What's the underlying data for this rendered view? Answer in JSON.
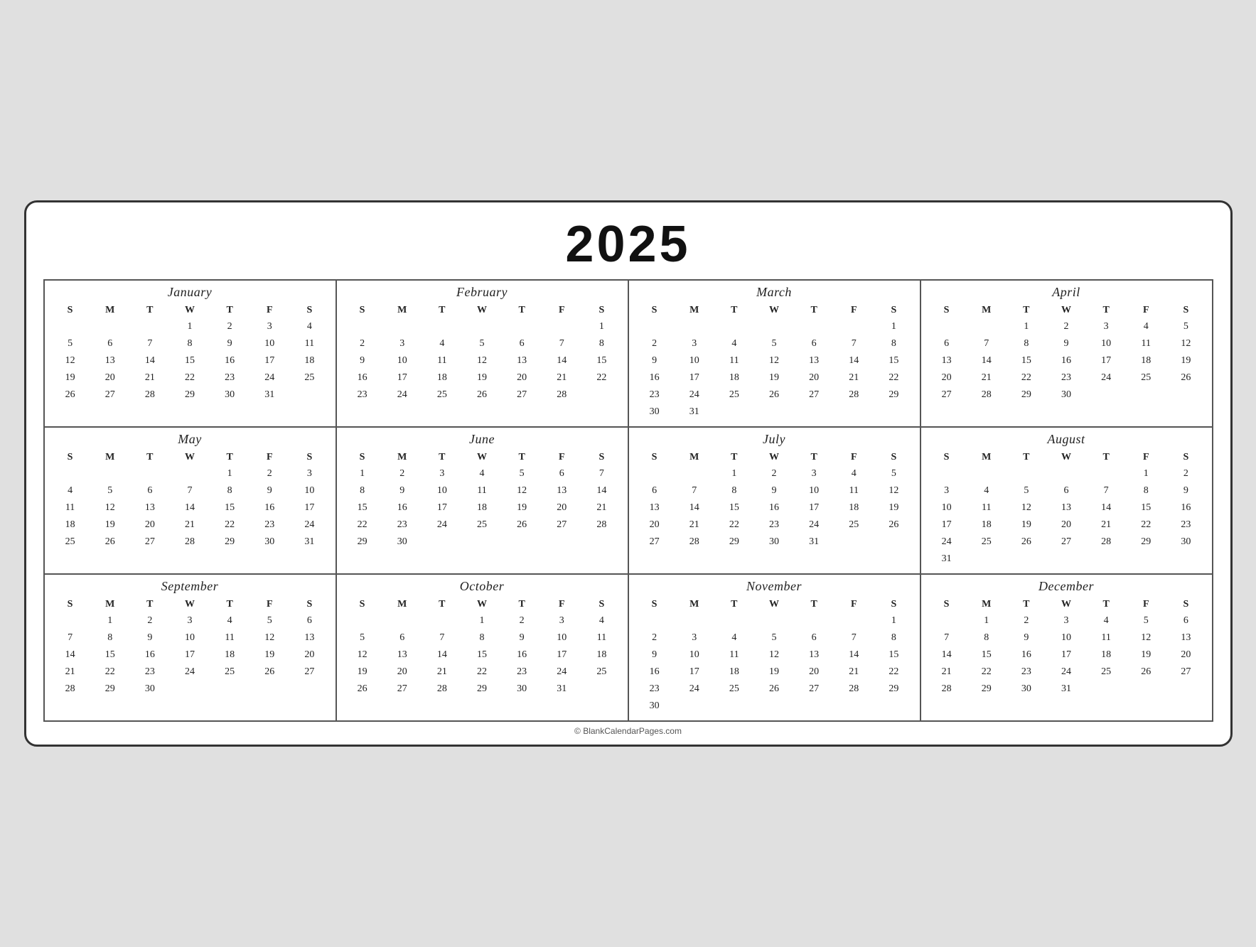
{
  "year": "2025",
  "footer": "© BlankCalendarPages.com",
  "months": [
    {
      "name": "January",
      "days_header": [
        "S",
        "M",
        "T",
        "W",
        "T",
        "F",
        "S"
      ],
      "weeks": [
        [
          "",
          "",
          "",
          "1",
          "2",
          "3",
          "4"
        ],
        [
          "5",
          "6",
          "7",
          "8",
          "9",
          "10",
          "11"
        ],
        [
          "12",
          "13",
          "14",
          "15",
          "16",
          "17",
          "18"
        ],
        [
          "19",
          "20",
          "21",
          "22",
          "23",
          "24",
          "25"
        ],
        [
          "26",
          "27",
          "28",
          "29",
          "30",
          "31",
          ""
        ]
      ]
    },
    {
      "name": "February",
      "days_header": [
        "S",
        "M",
        "T",
        "W",
        "T",
        "F",
        "S"
      ],
      "weeks": [
        [
          "",
          "",
          "",
          "",
          "",
          "",
          "1"
        ],
        [
          "2",
          "3",
          "4",
          "5",
          "6",
          "7",
          "8"
        ],
        [
          "9",
          "10",
          "11",
          "12",
          "13",
          "14",
          "15"
        ],
        [
          "16",
          "17",
          "18",
          "19",
          "20",
          "21",
          "22"
        ],
        [
          "23",
          "24",
          "25",
          "26",
          "27",
          "28",
          ""
        ]
      ]
    },
    {
      "name": "March",
      "days_header": [
        "S",
        "M",
        "T",
        "W",
        "T",
        "F",
        "S"
      ],
      "weeks": [
        [
          "",
          "",
          "",
          "",
          "",
          "",
          "1"
        ],
        [
          "2",
          "3",
          "4",
          "5",
          "6",
          "7",
          "8"
        ],
        [
          "9",
          "10",
          "11",
          "12",
          "13",
          "14",
          "15"
        ],
        [
          "16",
          "17",
          "18",
          "19",
          "20",
          "21",
          "22"
        ],
        [
          "23",
          "24",
          "25",
          "26",
          "27",
          "28",
          "29"
        ],
        [
          "30",
          "31",
          "",
          "",
          "",
          "",
          ""
        ]
      ]
    },
    {
      "name": "April",
      "days_header": [
        "S",
        "M",
        "T",
        "W",
        "T",
        "F",
        "S"
      ],
      "weeks": [
        [
          "",
          "",
          "1",
          "2",
          "3",
          "4",
          "5"
        ],
        [
          "6",
          "7",
          "8",
          "9",
          "10",
          "11",
          "12"
        ],
        [
          "13",
          "14",
          "15",
          "16",
          "17",
          "18",
          "19"
        ],
        [
          "20",
          "21",
          "22",
          "23",
          "24",
          "25",
          "26"
        ],
        [
          "27",
          "28",
          "29",
          "30",
          "",
          "",
          ""
        ]
      ]
    },
    {
      "name": "May",
      "days_header": [
        "S",
        "M",
        "T",
        "W",
        "T",
        "F",
        "S"
      ],
      "weeks": [
        [
          "",
          "",
          "",
          "",
          "1",
          "2",
          "3"
        ],
        [
          "4",
          "5",
          "6",
          "7",
          "8",
          "9",
          "10"
        ],
        [
          "11",
          "12",
          "13",
          "14",
          "15",
          "16",
          "17"
        ],
        [
          "18",
          "19",
          "20",
          "21",
          "22",
          "23",
          "24"
        ],
        [
          "25",
          "26",
          "27",
          "28",
          "29",
          "30",
          "31"
        ]
      ]
    },
    {
      "name": "June",
      "days_header": [
        "S",
        "M",
        "T",
        "W",
        "T",
        "F",
        "S"
      ],
      "weeks": [
        [
          "1",
          "2",
          "3",
          "4",
          "5",
          "6",
          "7"
        ],
        [
          "8",
          "9",
          "10",
          "11",
          "12",
          "13",
          "14"
        ],
        [
          "15",
          "16",
          "17",
          "18",
          "19",
          "20",
          "21"
        ],
        [
          "22",
          "23",
          "24",
          "25",
          "26",
          "27",
          "28"
        ],
        [
          "29",
          "30",
          "",
          "",
          "",
          "",
          ""
        ]
      ]
    },
    {
      "name": "July",
      "days_header": [
        "S",
        "M",
        "T",
        "W",
        "T",
        "F",
        "S"
      ],
      "weeks": [
        [
          "",
          "",
          "1",
          "2",
          "3",
          "4",
          "5"
        ],
        [
          "6",
          "7",
          "8",
          "9",
          "10",
          "11",
          "12"
        ],
        [
          "13",
          "14",
          "15",
          "16",
          "17",
          "18",
          "19"
        ],
        [
          "20",
          "21",
          "22",
          "23",
          "24",
          "25",
          "26"
        ],
        [
          "27",
          "28",
          "29",
          "30",
          "31",
          "",
          ""
        ]
      ]
    },
    {
      "name": "August",
      "days_header": [
        "S",
        "M",
        "T",
        "W",
        "T",
        "F",
        "S"
      ],
      "weeks": [
        [
          "",
          "",
          "",
          "",
          "",
          "1",
          "2"
        ],
        [
          "3",
          "4",
          "5",
          "6",
          "7",
          "8",
          "9"
        ],
        [
          "10",
          "11",
          "12",
          "13",
          "14",
          "15",
          "16"
        ],
        [
          "17",
          "18",
          "19",
          "20",
          "21",
          "22",
          "23"
        ],
        [
          "24",
          "25",
          "26",
          "27",
          "28",
          "29",
          "30"
        ],
        [
          "31",
          "",
          "",
          "",
          "",
          "",
          ""
        ]
      ]
    },
    {
      "name": "September",
      "days_header": [
        "S",
        "M",
        "T",
        "W",
        "T",
        "F",
        "S"
      ],
      "weeks": [
        [
          "",
          "1",
          "2",
          "3",
          "4",
          "5",
          "6"
        ],
        [
          "7",
          "8",
          "9",
          "10",
          "11",
          "12",
          "13"
        ],
        [
          "14",
          "15",
          "16",
          "17",
          "18",
          "19",
          "20"
        ],
        [
          "21",
          "22",
          "23",
          "24",
          "25",
          "26",
          "27"
        ],
        [
          "28",
          "29",
          "30",
          "",
          "",
          "",
          ""
        ]
      ]
    },
    {
      "name": "October",
      "days_header": [
        "S",
        "M",
        "T",
        "W",
        "T",
        "F",
        "S"
      ],
      "weeks": [
        [
          "",
          "",
          "",
          "1",
          "2",
          "3",
          "4"
        ],
        [
          "5",
          "6",
          "7",
          "8",
          "9",
          "10",
          "11"
        ],
        [
          "12",
          "13",
          "14",
          "15",
          "16",
          "17",
          "18"
        ],
        [
          "19",
          "20",
          "21",
          "22",
          "23",
          "24",
          "25"
        ],
        [
          "26",
          "27",
          "28",
          "29",
          "30",
          "31",
          ""
        ]
      ]
    },
    {
      "name": "November",
      "days_header": [
        "S",
        "M",
        "T",
        "W",
        "T",
        "F",
        "S"
      ],
      "weeks": [
        [
          "",
          "",
          "",
          "",
          "",
          "",
          "1"
        ],
        [
          "2",
          "3",
          "4",
          "5",
          "6",
          "7",
          "8"
        ],
        [
          "9",
          "10",
          "11",
          "12",
          "13",
          "14",
          "15"
        ],
        [
          "16",
          "17",
          "18",
          "19",
          "20",
          "21",
          "22"
        ],
        [
          "23",
          "24",
          "25",
          "26",
          "27",
          "28",
          "29"
        ],
        [
          "30",
          "",
          "",
          "",
          "",
          "",
          ""
        ]
      ]
    },
    {
      "name": "December",
      "days_header": [
        "S",
        "M",
        "T",
        "W",
        "T",
        "F",
        "S"
      ],
      "weeks": [
        [
          "",
          "1",
          "2",
          "3",
          "4",
          "5",
          "6"
        ],
        [
          "7",
          "8",
          "9",
          "10",
          "11",
          "12",
          "13"
        ],
        [
          "14",
          "15",
          "16",
          "17",
          "18",
          "19",
          "20"
        ],
        [
          "21",
          "22",
          "23",
          "24",
          "25",
          "26",
          "27"
        ],
        [
          "28",
          "29",
          "30",
          "31",
          "",
          "",
          ""
        ]
      ]
    }
  ]
}
